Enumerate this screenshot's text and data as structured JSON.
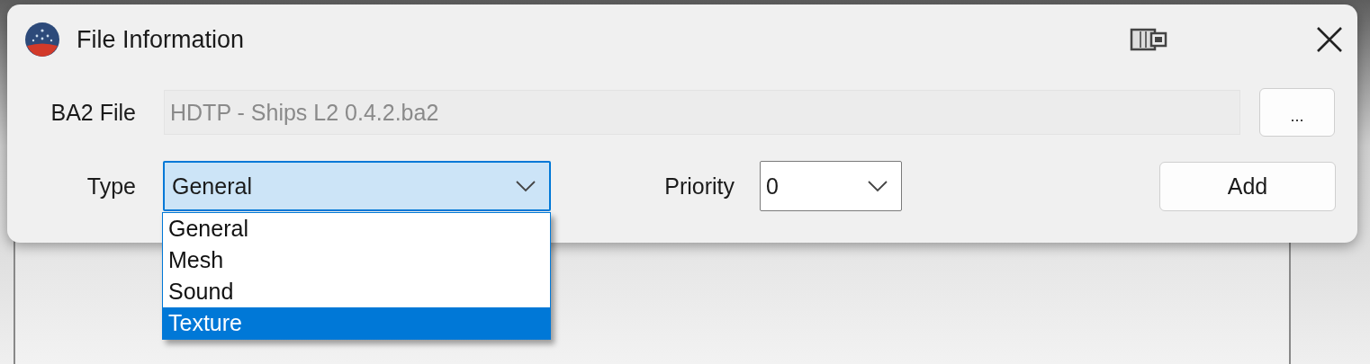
{
  "window": {
    "title": "File Information"
  },
  "ba2_file": {
    "label": "BA2 File",
    "value": "HDTP - Ships L2 0.4.2.ba2",
    "disabled": true,
    "browse_button": "..."
  },
  "type": {
    "label": "Type",
    "value": "General",
    "expanded": true,
    "options": [
      {
        "label": "General",
        "highlighted": false
      },
      {
        "label": "Mesh",
        "highlighted": false
      },
      {
        "label": "Sound",
        "highlighted": false
      },
      {
        "label": "Texture",
        "highlighted": true
      }
    ]
  },
  "priority": {
    "label": "Priority",
    "value": "0"
  },
  "add_button": "Add"
}
